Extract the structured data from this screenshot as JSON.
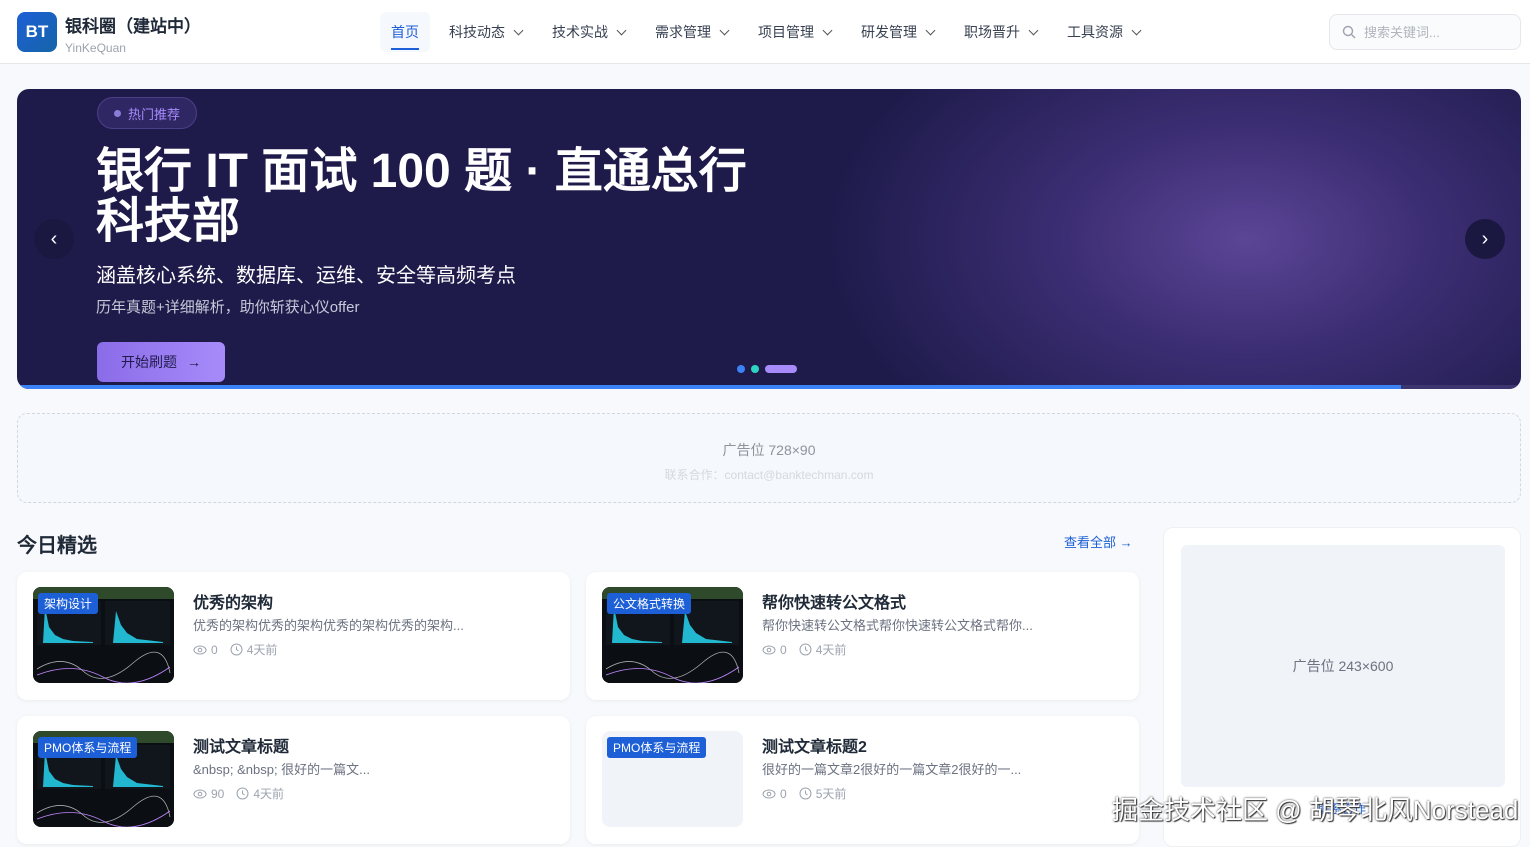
{
  "header": {
    "logo": "BT",
    "title": "银科圈（建站中）",
    "subtitle": "YinKeQuan",
    "nav": [
      {
        "label": "首页",
        "active": true
      },
      {
        "label": "科技动态"
      },
      {
        "label": "技术实战"
      },
      {
        "label": "需求管理"
      },
      {
        "label": "项目管理"
      },
      {
        "label": "研发管理"
      },
      {
        "label": "职场晋升"
      },
      {
        "label": "工具资源"
      }
    ],
    "search_placeholder": "搜索关键词..."
  },
  "hero": {
    "badge": "热门推荐",
    "title": "银行 IT 面试 100 题 · 直通总行科技部",
    "subtitle": "涵盖核心系统、数据库、运维、安全等高频考点",
    "desc": "历年真题+详细解析，助你斩获心仪offer",
    "cta": "开始刷题",
    "prev": "‹",
    "next": "›",
    "slide_count": 3,
    "active_slide": 3,
    "progress": 0.92,
    "dot_colors": [
      "#3b82f6",
      "#2dd4bf",
      "#a78bfa"
    ]
  },
  "ad_banner": {
    "label": "广告位 728×90",
    "contact": "联系合作：contact@banktechman.com"
  },
  "section": {
    "title": "今日精选",
    "view_all": "查看全部 →"
  },
  "articles": [
    {
      "tag": "架构设计",
      "title": "优秀的架构",
      "desc": "优秀的架构优秀的架构优秀的架构优秀的架构...",
      "views": "0",
      "time": "4天前",
      "image": true
    },
    {
      "tag": "公文格式转换",
      "title": "帮你快速转公文格式",
      "desc": "帮你快速转公文格式帮你快速转公文格式帮你...",
      "views": "0",
      "time": "4天前",
      "image": true
    },
    {
      "tag": "PMO体系与流程",
      "title": "测试文章标题",
      "desc": "&nbsp; &nbsp; 很好的一篇文...",
      "views": "90",
      "time": "4天前",
      "image": true
    },
    {
      "tag": "PMO体系与流程",
      "title": "测试文章标题2",
      "desc": "很好的一篇文章2很好的一篇文章2很好的一...",
      "views": "0",
      "time": "5天前",
      "image": false
    }
  ],
  "sidebar_ad": {
    "label": "广告位 243×600",
    "link": "联系合作"
  },
  "watermark": "掘金技术社区 @ 胡琴北风Norstead",
  "colors": {
    "primary": "#1d5fd6",
    "hero_bg": "#1e1b4b",
    "accent": "#a78bfa"
  }
}
